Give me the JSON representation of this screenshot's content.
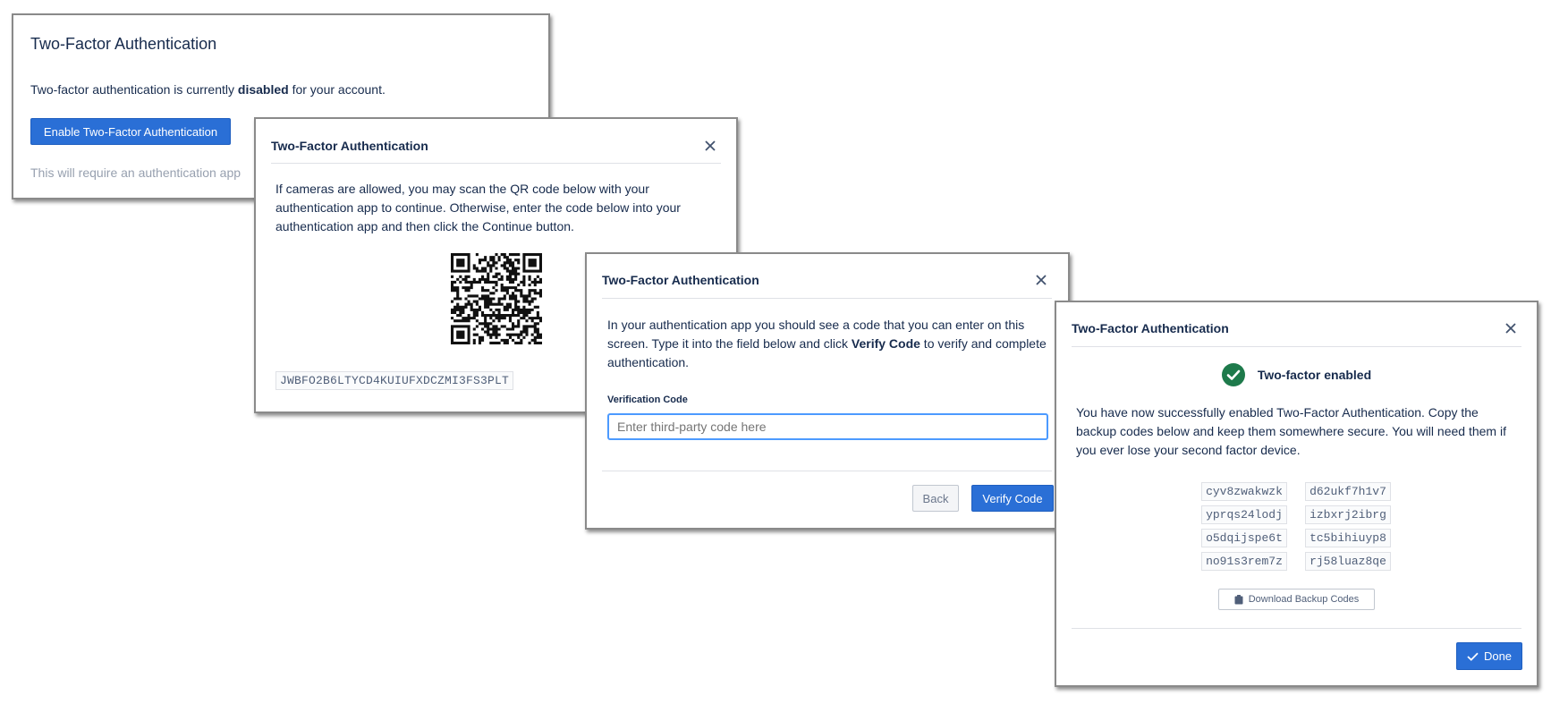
{
  "app_title": "Two-Factor Authentication",
  "panel1": {
    "title": "Two-Factor Authentication",
    "status_prefix": "Two-factor authentication is currently ",
    "status_value": "disabled",
    "status_suffix": " for your account.",
    "enable_button": "Enable Two-Factor Authentication",
    "note": "This will require an authentication app"
  },
  "panel2": {
    "title": "Two-Factor Authentication",
    "instructions": "If cameras are allowed, you may scan the QR code below with your authentication app to continue. Otherwise, enter the code below into your authentication app and then click the Continue button.",
    "secret_code": "JWBFO2B6LTYCD4KUIUFXDCZMI3FS3PLT"
  },
  "panel3": {
    "title": "Two-Factor Authentication",
    "instructions_prefix": "In your authentication app you should see a code that you can enter on this screen. Type it into the field below and click ",
    "instructions_bold": "Verify Code",
    "instructions_suffix": " to verify and complete authentication.",
    "field_label": "Verification Code",
    "field_placeholder": "Enter third-party code here",
    "field_value": "",
    "back_button": "Back",
    "verify_button": "Verify Code"
  },
  "panel4": {
    "title": "Two-Factor Authentication",
    "success_text": "Two-factor enabled",
    "message": "You have now successfully enabled Two-Factor Authentication. Copy the backup codes below and keep them somewhere secure. You will need them if you ever lose your second factor device.",
    "backup_codes": [
      "cyv8zwakwzk",
      "d62ukf7h1v7",
      "yprqs24lodj",
      "izbxrj2ibrg",
      "o5dqijspe6t",
      "tc5bihiuyp8",
      "no91s3rem7z",
      "rj58luaz8qe"
    ],
    "download_button": "Download Backup Codes",
    "done_button": "Done"
  },
  "icons": {
    "close": "close-icon",
    "success": "check-circle-icon",
    "download": "clipboard-icon",
    "done": "checkmark-icon"
  },
  "colors": {
    "primary": "#2a6fd6",
    "success": "#1e7a4b",
    "muted_text": "#97a0af"
  }
}
